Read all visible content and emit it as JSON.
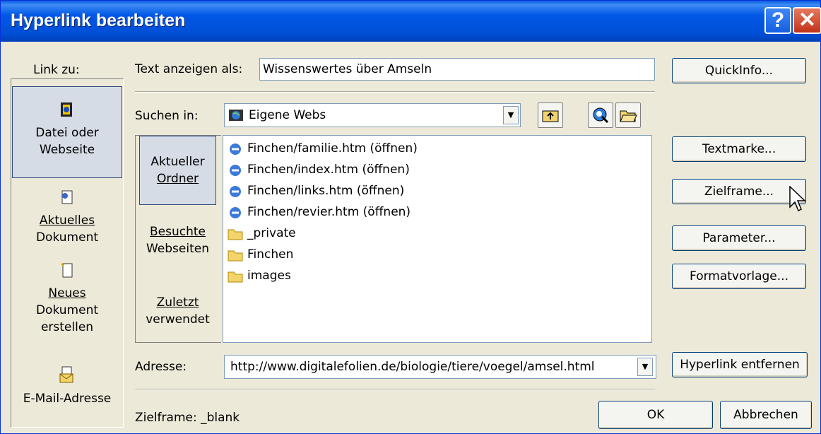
{
  "window": {
    "title": "Hyperlink bearbeiten",
    "help": "?",
    "close": "✕"
  },
  "link_to": {
    "label": "Link zu:",
    "items": [
      {
        "line1": "Datei oder",
        "line2": "Webseite",
        "line3": "",
        "icon": "web-page-icon",
        "selected": true
      },
      {
        "line1": "Aktuelles",
        "line2": "Dokument",
        "line3": "",
        "icon": "document-icon",
        "selected": false
      },
      {
        "line1": "Neues",
        "line2": "Dokument",
        "line3": "erstellen",
        "icon": "new-document-icon",
        "selected": false
      },
      {
        "line1": "E-Mail-Adresse",
        "line2": "",
        "line3": "",
        "icon": "email-icon",
        "selected": false
      }
    ]
  },
  "display_text": {
    "label": "Text anzeigen als:",
    "value": "Wissenswertes über Amseln"
  },
  "look_in": {
    "label": "Suchen in:",
    "value": "Eigene Webs"
  },
  "views": [
    {
      "line1": "Aktueller",
      "line2": "Ordner",
      "selected": true
    },
    {
      "line1": "Besuchte",
      "line2": "Webseiten",
      "selected": false
    },
    {
      "line1": "Zuletzt",
      "line2": "verwendet",
      "selected": false
    }
  ],
  "files": [
    {
      "name": "Finchen/familie.htm (öffnen)",
      "icon": "ie-document-icon"
    },
    {
      "name": "Finchen/index.htm (öffnen)",
      "icon": "ie-document-icon"
    },
    {
      "name": "Finchen/links.htm (öffnen)",
      "icon": "ie-document-icon"
    },
    {
      "name": "Finchen/revier.htm (öffnen)",
      "icon": "ie-document-icon"
    },
    {
      "name": "_private",
      "icon": "folder-icon"
    },
    {
      "name": "Finchen",
      "icon": "folder-icon"
    },
    {
      "name": "images",
      "icon": "folder-icon"
    }
  ],
  "address": {
    "label": "Adresse:",
    "value": "http://www.digitalefolien.de/biologie/tiere/voegel/amsel.html"
  },
  "target_frame_status": "Zielframe: _blank",
  "buttons": {
    "quickinfo": "QuickInfo...",
    "bookmark": "Textmarke...",
    "target_frame": "Zielframe...",
    "parameter": "Parameter...",
    "style": "Formatvorlage...",
    "remove_link": "Hyperlink entfernen",
    "ok": "OK",
    "cancel": "Abbrechen"
  },
  "colors": {
    "titlebar": "#0058e6",
    "dialog": "#ece9d8",
    "selection": "#d6dce6"
  }
}
